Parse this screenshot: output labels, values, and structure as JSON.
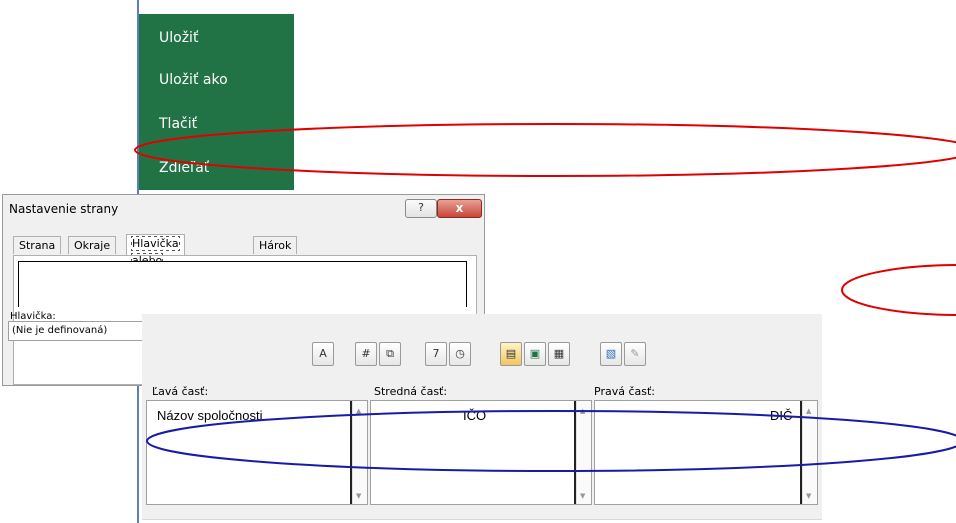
{
  "backstage": {
    "items": [
      "Uložiť",
      "Uložiť ako",
      "Tlačiť",
      "Zdieľať"
    ],
    "color": "#217346"
  },
  "page_setup": {
    "title": "Nastavenie strany",
    "help_glyph": "?",
    "close_glyph": "x",
    "tabs": [
      "Strana",
      "Okraje",
      "Hlavička alebo päta",
      "Hárok"
    ],
    "active_tab": "Hlavička alebo päta",
    "header_label": "Hlavička:",
    "header_value": "(Nie je definovaná)"
  },
  "header_editor": {
    "toolbar": [
      {
        "icon": "format-text-icon",
        "glyph": "A"
      },
      {
        "icon": "page-number-icon",
        "glyph": "#"
      },
      {
        "icon": "page-count-icon",
        "glyph": "⧉"
      },
      {
        "icon": "date-icon",
        "glyph": "7"
      },
      {
        "icon": "time-icon",
        "glyph": "◷"
      },
      {
        "icon": "file-path-icon",
        "glyph": "▤"
      },
      {
        "icon": "file-name-icon",
        "glyph": "▣"
      },
      {
        "icon": "sheet-name-icon",
        "glyph": "▦"
      },
      {
        "icon": "insert-picture-icon",
        "glyph": "▧"
      },
      {
        "icon": "format-picture-icon",
        "glyph": "✎"
      }
    ],
    "sections": [
      {
        "label": "Ľavá časť:",
        "text": "Názov spoločnosti"
      },
      {
        "label": "Stredná časť:",
        "text": "IČO"
      },
      {
        "label": "Pravá časť:",
        "text": "DIČ"
      }
    ]
  },
  "annotations": {
    "red": "#e00000",
    "blue": "#1a1aa8"
  }
}
